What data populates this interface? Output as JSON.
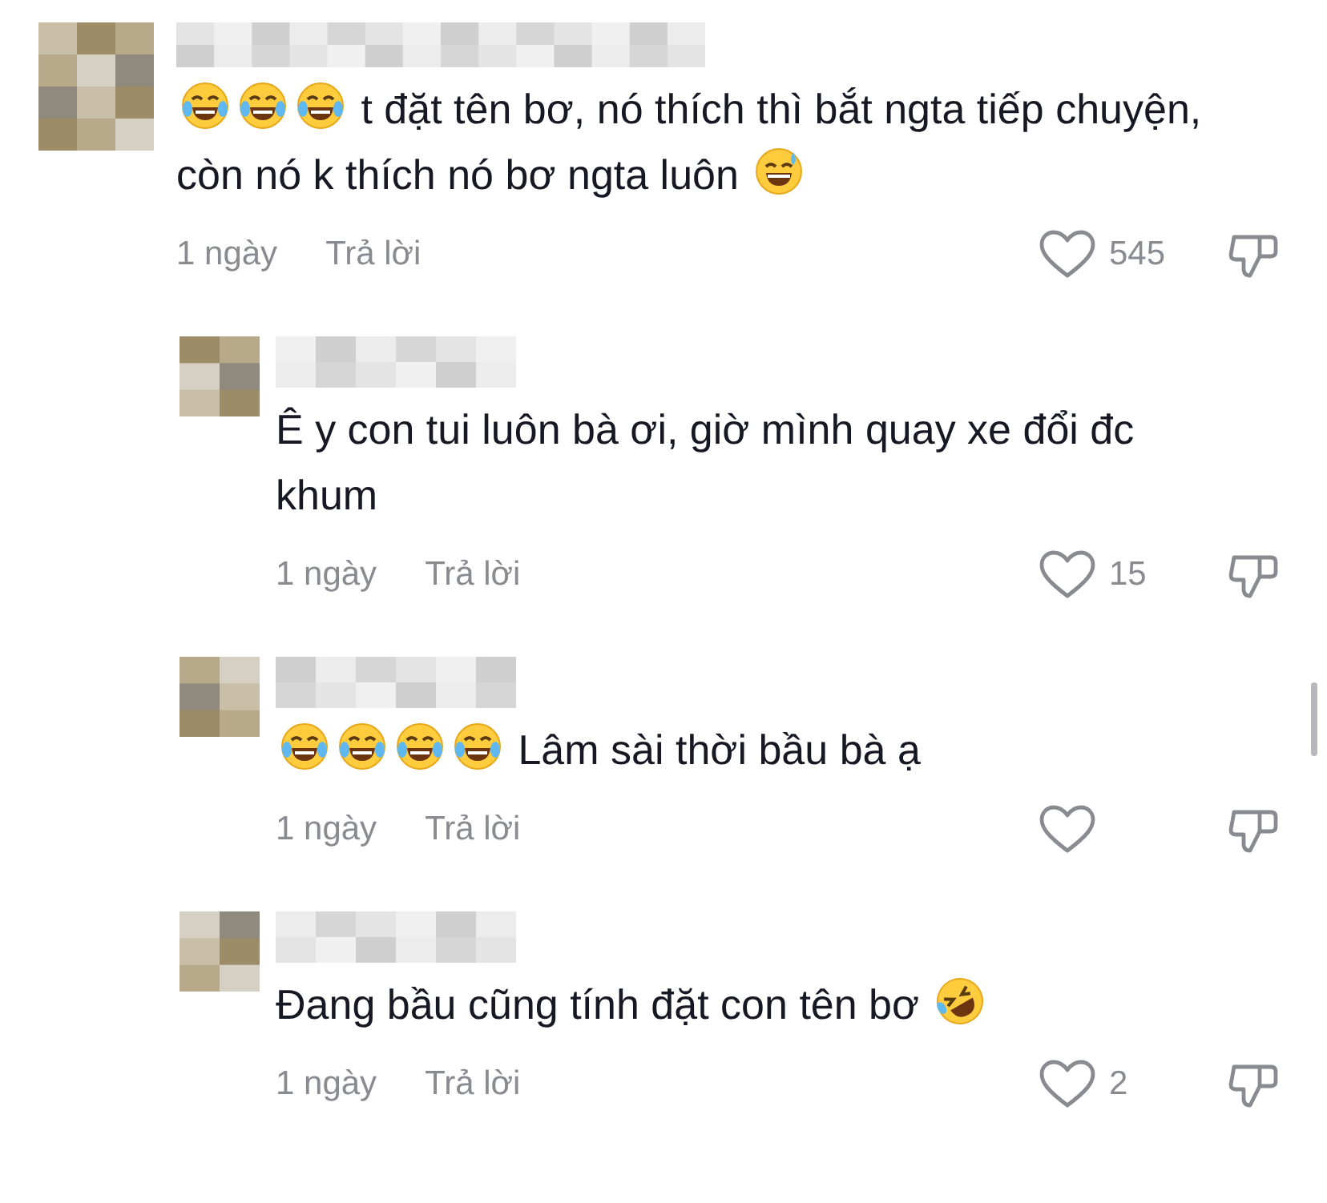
{
  "comments": [
    {
      "reply": false,
      "parts": [
        {
          "kind": "tears_of_joy"
        },
        {
          "kind": "tears_of_joy"
        },
        {
          "kind": "tears_of_joy"
        },
        {
          "kind": "text",
          "text": "t đặt tên bơ, nó thích thì bắt ngta tiếp chuyện, còn nó k thích nó bơ ngta luôn"
        },
        {
          "kind": "sweat_smile"
        }
      ],
      "time": "1 ngày",
      "reply_label": "Trả lời",
      "likes": "545"
    },
    {
      "reply": true,
      "parts": [
        {
          "kind": "text",
          "text": "Ê y con tui luôn bà ơi, giờ mình quay xe đổi đc khum"
        }
      ],
      "time": "1 ngày",
      "reply_label": "Trả lời",
      "likes": "15"
    },
    {
      "reply": true,
      "parts": [
        {
          "kind": "tears_of_joy"
        },
        {
          "kind": "tears_of_joy"
        },
        {
          "kind": "tears_of_joy"
        },
        {
          "kind": "tears_of_joy"
        },
        {
          "kind": "text",
          "text": "Lâm sài thời bầu bà ạ"
        }
      ],
      "time": "1 ngày",
      "reply_label": "Trả lời"
    },
    {
      "reply": true,
      "parts": [
        {
          "kind": "text",
          "text": "Đang bầu cũng tính đặt con tên bơ"
        },
        {
          "kind": "rofl"
        }
      ],
      "time": "1 ngày",
      "reply_label": "Trả lời",
      "likes": "2"
    }
  ]
}
